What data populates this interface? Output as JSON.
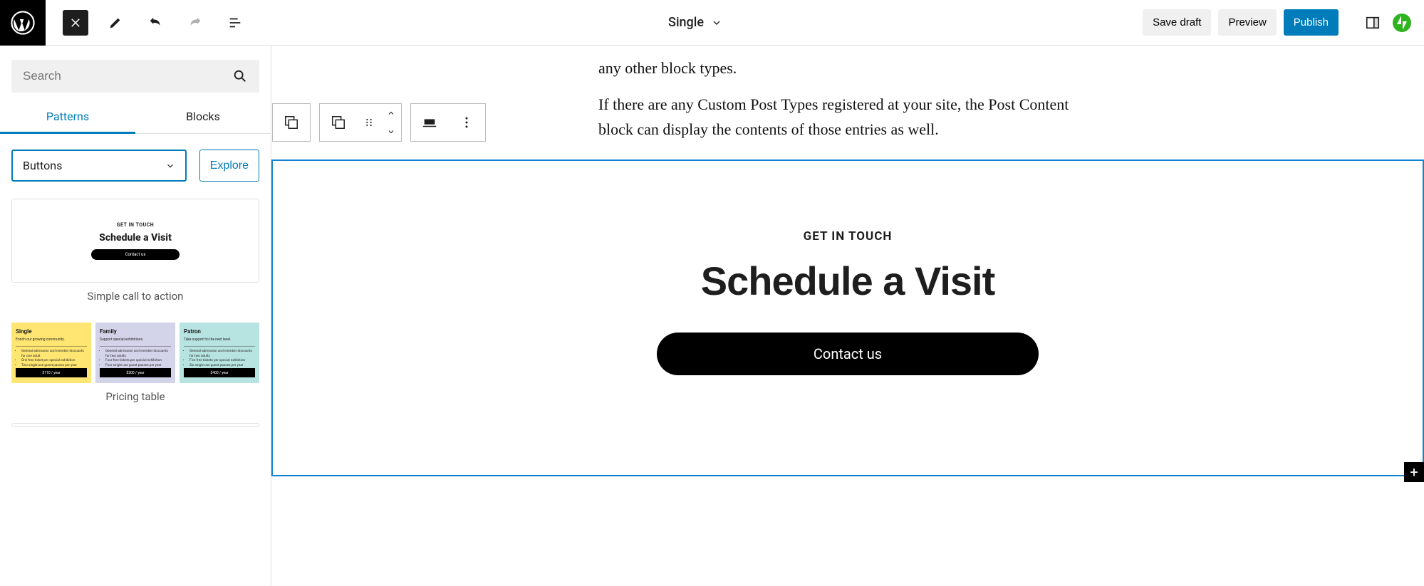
{
  "topbar": {
    "template_name": "Single",
    "save_draft": "Save draft",
    "preview": "Preview",
    "publish": "Publish"
  },
  "sidebar": {
    "search_placeholder": "Search",
    "tab_patterns": "Patterns",
    "tab_blocks": "Blocks",
    "category_selected": "Buttons",
    "explore": "Explore",
    "patterns": [
      {
        "name": "Simple call to action",
        "kicker": "GET IN TOUCH",
        "title": "Schedule a Visit",
        "button": "Contact us"
      },
      {
        "name": "Pricing table",
        "tiers": [
          {
            "title": "Single",
            "subtitle": "Enrich our growing community.",
            "features": [
              "General admission and member discounts for one adult",
              "One free ticket per special exhibition",
              "Two single-use guest passes per year"
            ],
            "price": "$110 / year"
          },
          {
            "title": "Family",
            "subtitle": "Support special exhibitions.",
            "features": [
              "General admission and member discounts for two adults",
              "Four free tickets per special exhibition",
              "Four single-use guest passes per year"
            ],
            "price": "$200 / year"
          },
          {
            "title": "Patron",
            "subtitle": "Take support to the next level.",
            "features": [
              "General admission and member discounts for two adults",
              "Five free tickets per special exhibition",
              "Six single-use guest passes per year"
            ],
            "price": "$400 / year"
          }
        ]
      }
    ]
  },
  "editor": {
    "paragraph1_tail": "any other block types.",
    "paragraph2": "If there are any Custom Post Types registered at your site, the Post Content block can display the contents of those entries as well.",
    "selected": {
      "kicker": "GET IN TOUCH",
      "heading": "Schedule a Visit",
      "button": "Contact us"
    }
  }
}
